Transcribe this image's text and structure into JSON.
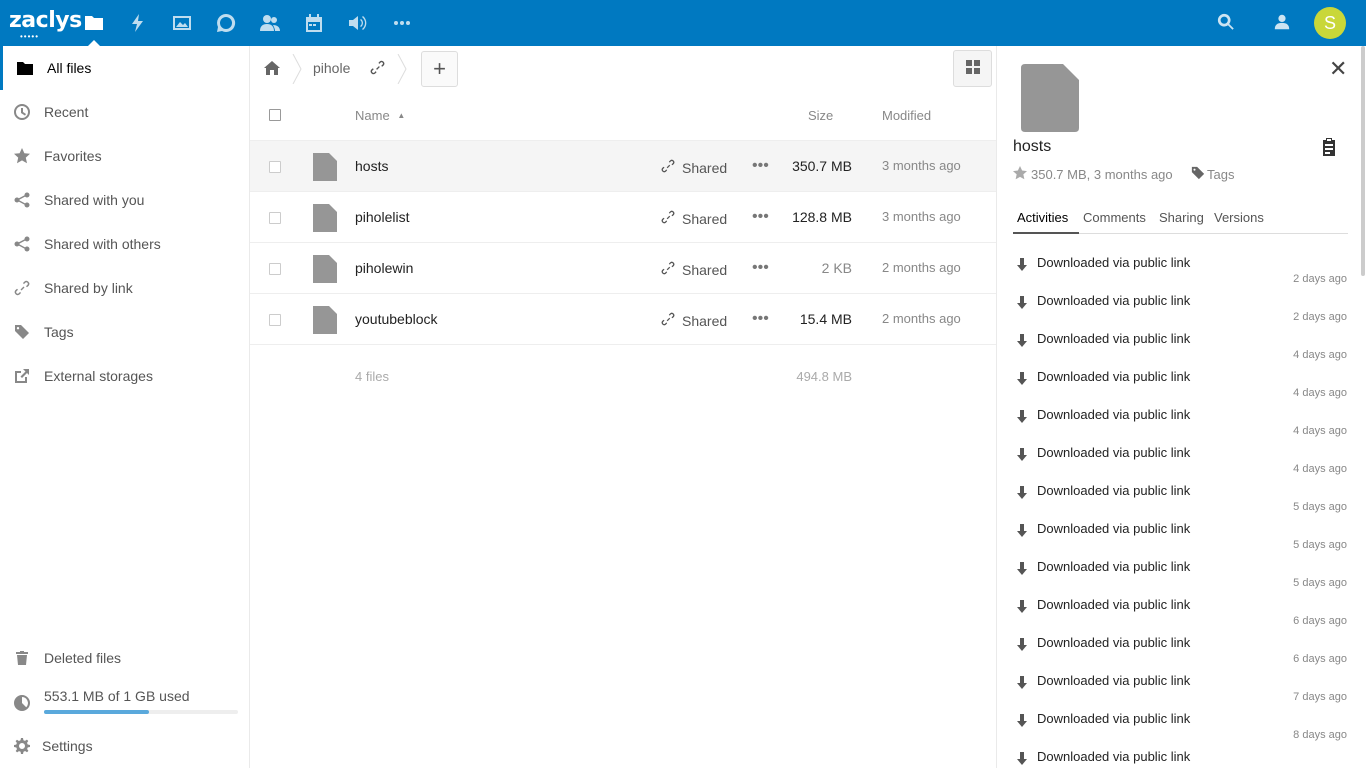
{
  "header": {
    "logo_text": "zaclys",
    "logo_dots": "•••••",
    "apps": [
      "files-icon",
      "activity-icon",
      "gallery-icon",
      "talk-icon",
      "contacts-icon",
      "calendar-icon",
      "audio-icon",
      "more-apps-icon"
    ],
    "avatar_letter": "S",
    "avatar_color": "#c9d739",
    "brand_color": "#0079c1"
  },
  "sidebar": {
    "items": [
      {
        "label": "All files",
        "icon": "folder-icon"
      },
      {
        "label": "Recent",
        "icon": "clock-icon"
      },
      {
        "label": "Favorites",
        "icon": "star-icon"
      },
      {
        "label": "Shared with you",
        "icon": "share-icon"
      },
      {
        "label": "Shared with others",
        "icon": "share-icon"
      },
      {
        "label": "Shared by link",
        "icon": "link-icon"
      },
      {
        "label": "Tags",
        "icon": "tag-icon"
      },
      {
        "label": "External storages",
        "icon": "external-icon"
      }
    ],
    "deleted_label": "Deleted files",
    "quota_label": "553.1 MB of 1 GB used",
    "quota_fraction": 0.54,
    "settings_label": "Settings"
  },
  "main": {
    "breadcrumb_folder": "pihole",
    "new_button": "+",
    "columns": {
      "name": "Name",
      "size": "Size",
      "modified": "Modified"
    },
    "files": [
      {
        "name": "hosts",
        "share": "Shared",
        "more": "•••",
        "size": "350.7 MB",
        "modified": "3 months ago"
      },
      {
        "name": "piholelist",
        "share": "Shared",
        "more": "•••",
        "size": "128.8 MB",
        "modified": "3 months ago"
      },
      {
        "name": "piholewin",
        "share": "Shared",
        "more": "•••",
        "size": "2 KB",
        "modified": "2 months ago"
      },
      {
        "name": "youtubeblock",
        "share": "Shared",
        "more": "•••",
        "size": "15.4 MB",
        "modified": "2 months ago"
      }
    ],
    "summary_count": "4 files",
    "summary_size": "494.8 MB"
  },
  "details": {
    "title": "hosts",
    "meta": "350.7 MB, 3 months ago",
    "tags_label": "Tags",
    "close": "✕",
    "tabs": [
      "Activities",
      "Comments",
      "Sharing",
      "Versions"
    ],
    "activities": [
      {
        "text": "Downloaded via public link",
        "when": "2 days ago"
      },
      {
        "text": "Downloaded via public link",
        "when": "2 days ago"
      },
      {
        "text": "Downloaded via public link",
        "when": "4 days ago"
      },
      {
        "text": "Downloaded via public link",
        "when": "4 days ago"
      },
      {
        "text": "Downloaded via public link",
        "when": "4 days ago"
      },
      {
        "text": "Downloaded via public link",
        "when": "4 days ago"
      },
      {
        "text": "Downloaded via public link",
        "when": "5 days ago"
      },
      {
        "text": "Downloaded via public link",
        "when": "5 days ago"
      },
      {
        "text": "Downloaded via public link",
        "when": "5 days ago"
      },
      {
        "text": "Downloaded via public link",
        "when": "6 days ago"
      },
      {
        "text": "Downloaded via public link",
        "when": "6 days ago"
      },
      {
        "text": "Downloaded via public link",
        "when": "7 days ago"
      },
      {
        "text": "Downloaded via public link",
        "when": "8 days ago"
      },
      {
        "text": "Downloaded via public link",
        "when": ""
      }
    ]
  }
}
